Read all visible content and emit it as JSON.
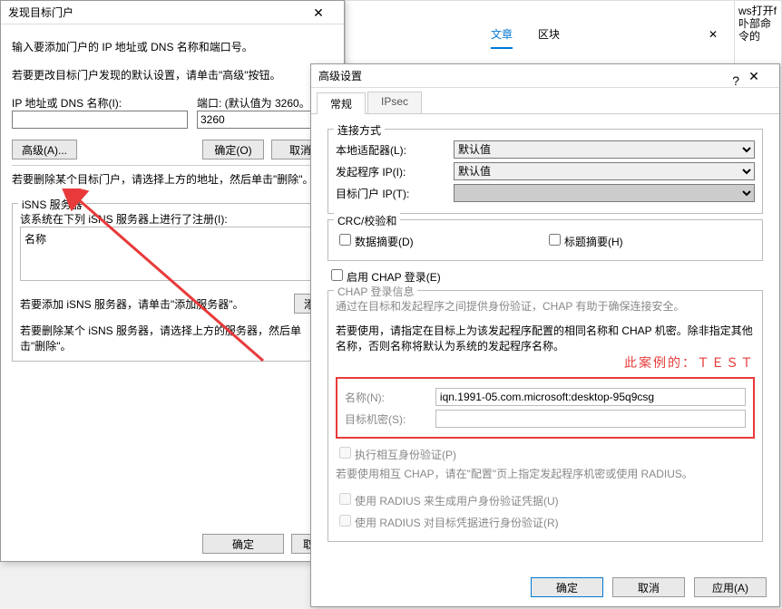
{
  "topstrip": {
    "tab_article": "文章",
    "tab_block": "区块",
    "close": "✕",
    "side_line1": "ws打开f",
    "side_line2": "卟部命令的"
  },
  "d1": {
    "title": "发现目标门户",
    "close": "✕",
    "intro": "输入要添加门户的 IP 地址或 DNS 名称和端口号。",
    "hint": "若要更改目标门户发现的默认设置，请单击\"高级\"按钮。",
    "ip_label": "IP 地址或 DNS 名称(I):",
    "port_label": "端口: (默认值为 3260。",
    "port_value": "3260",
    "adv_btn": "高级(A)...",
    "ok_btn": "确定(O)",
    "cancel_btn": "取消(",
    "del_text": "若要删除某个目标门户，请选择上方的地址，然后单击\"删除\"。",
    "isns_title": "iSNS 服务器",
    "isns_reg": "该系统在下列 iSNS 服务器上进行了注册(I):",
    "col_name": "名称",
    "isns_add": "若要添加 iSNS 服务器，请单击\"添加服务器\"。",
    "isns_add_btn": "添",
    "isns_del": "若要删除某个 iSNS 服务器，请选择上方的服务器，然后单击\"删除\"。",
    "f_ok": "确定",
    "f_cancel": "取消"
  },
  "d2": {
    "title": "高级设置",
    "help": "?",
    "close": "✕",
    "tab_general": "常规",
    "tab_ipsec": "IPsec",
    "grp_conn": "连接方式",
    "adapter_label": "本地适配器(L):",
    "adapter_val": "默认值",
    "initiator_label": "发起程序 IP(I):",
    "initiator_val": "默认值",
    "target_label": "目标门户 IP(T):",
    "target_val": "",
    "grp_crc": "CRC/校验和",
    "crc_data": "数据摘要(D)",
    "crc_header": "标题摘要(H)",
    "chap_enable": "启用 CHAP 登录(E)",
    "grp_chap": "CHAP 登录信息",
    "chap_desc": "通过在目标和发起程序之间提供身份验证，CHAP 有助于确保连接安全。",
    "chap_desc2": "若要使用，请指定在目标上为该发起程序配置的相同名称和 CHAP 机密。除非指定其他名称，否则名称将默认为系统的发起程序名称。",
    "red_label": "此案例的：ＴＥＳＴ",
    "name_label": "名称(N):",
    "name_val": "iqn.1991-05.com.microsoft:desktop-95q9csg",
    "secret_label": "目标机密(S):",
    "secret_val": "",
    "mutual": "执行相互身份验证(P)",
    "mutual_hint": "若要使用相互 CHAP，请在\"配置\"页上指定发起程序机密或使用 RADIUS。",
    "radius1": "使用 RADIUS 来生成用户身份验证凭据(U)",
    "radius2": "使用 RADIUS 对目标凭据进行身份验证(R)",
    "btn_ok": "确定",
    "btn_cancel": "取消",
    "btn_apply": "应用(A)"
  }
}
